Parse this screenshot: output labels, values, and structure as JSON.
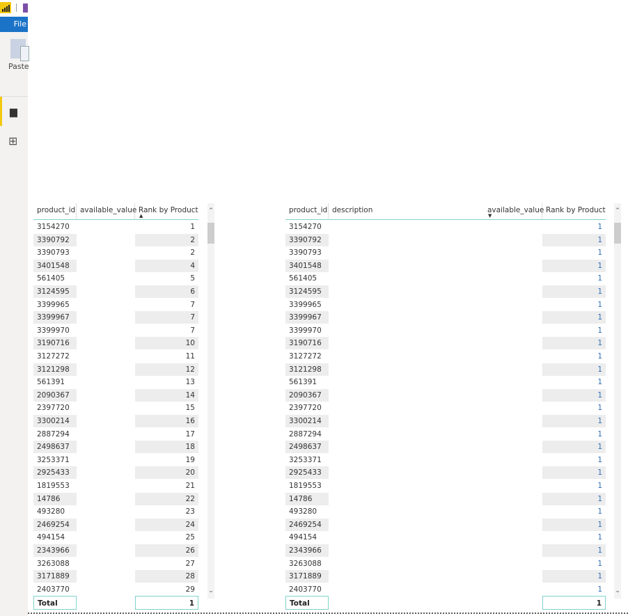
{
  "app": {
    "file_tab": "File",
    "paste_label": "Paste",
    "brand_color": "#f2c811",
    "file_tab_color": "#1b73c7"
  },
  "nav": {
    "report_icon": "bar-chart-icon",
    "model_icon": "model-icon"
  },
  "left_table": {
    "headers": [
      "product_id",
      "available_value",
      "Rank by Product"
    ],
    "sort": "ascending on Rank by Product",
    "rows": [
      [
        "3154270",
        "1"
      ],
      [
        "3390792",
        "2"
      ],
      [
        "3390793",
        "2"
      ],
      [
        "3401548",
        "4"
      ],
      [
        "561405",
        "5"
      ],
      [
        "3124595",
        "6"
      ],
      [
        "3399965",
        "7"
      ],
      [
        "3399967",
        "7"
      ],
      [
        "3399970",
        "7"
      ],
      [
        "3190716",
        "10"
      ],
      [
        "3127272",
        "11"
      ],
      [
        "3121298",
        "12"
      ],
      [
        "561391",
        "13"
      ],
      [
        "2090367",
        "14"
      ],
      [
        "2397720",
        "15"
      ],
      [
        "3300214",
        "16"
      ],
      [
        "2887294",
        "17"
      ],
      [
        "2498637",
        "18"
      ],
      [
        "3253371",
        "19"
      ],
      [
        "2925433",
        "20"
      ],
      [
        "1819553",
        "21"
      ],
      [
        "14786",
        "22"
      ],
      [
        "493280",
        "23"
      ],
      [
        "2469254",
        "24"
      ],
      [
        "494154",
        "25"
      ],
      [
        "2343966",
        "26"
      ],
      [
        "3263088",
        "27"
      ],
      [
        "3171889",
        "28"
      ],
      [
        "2403770",
        "29"
      ]
    ],
    "total_label": "Total",
    "total_value": "1"
  },
  "right_table": {
    "headers": [
      "product_id",
      "description",
      "available_value",
      "Rank by Product"
    ],
    "sort": "descending on available_value",
    "rows": [
      [
        "3154270",
        "1"
      ],
      [
        "3390792",
        "1"
      ],
      [
        "3390793",
        "1"
      ],
      [
        "3401548",
        "1"
      ],
      [
        "561405",
        "1"
      ],
      [
        "3124595",
        "1"
      ],
      [
        "3399965",
        "1"
      ],
      [
        "3399967",
        "1"
      ],
      [
        "3399970",
        "1"
      ],
      [
        "3190716",
        "1"
      ],
      [
        "3127272",
        "1"
      ],
      [
        "3121298",
        "1"
      ],
      [
        "561391",
        "1"
      ],
      [
        "2090367",
        "1"
      ],
      [
        "2397720",
        "1"
      ],
      [
        "3300214",
        "1"
      ],
      [
        "2887294",
        "1"
      ],
      [
        "2498637",
        "1"
      ],
      [
        "3253371",
        "1"
      ],
      [
        "2925433",
        "1"
      ],
      [
        "1819553",
        "1"
      ],
      [
        "14786",
        "1"
      ],
      [
        "493280",
        "1"
      ],
      [
        "2469254",
        "1"
      ],
      [
        "494154",
        "1"
      ],
      [
        "2343966",
        "1"
      ],
      [
        "3263088",
        "1"
      ],
      [
        "3171889",
        "1"
      ],
      [
        "2403770",
        "1"
      ]
    ],
    "total_label": "Total",
    "total_value": "1"
  }
}
